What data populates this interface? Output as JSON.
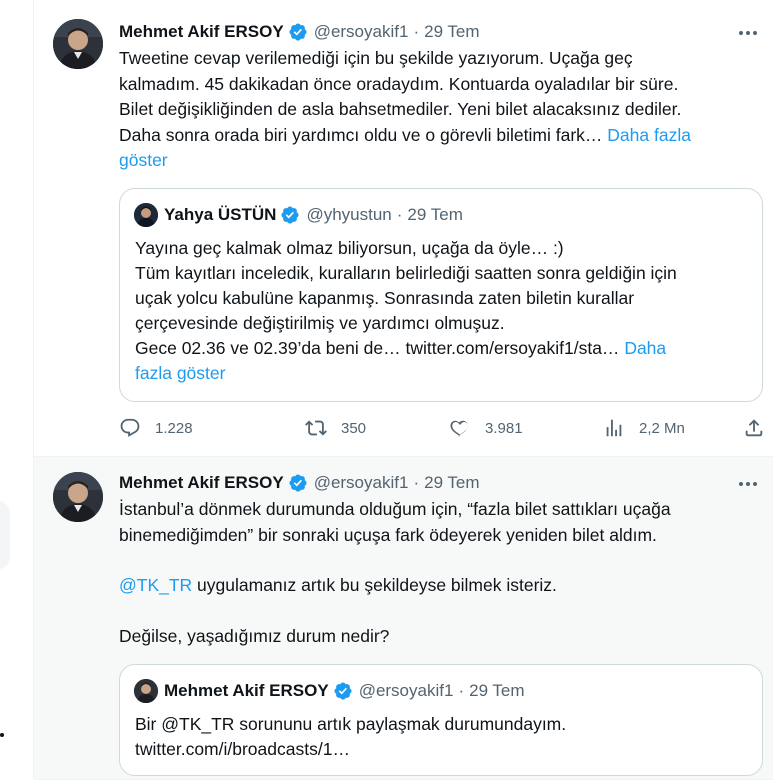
{
  "tweets": [
    {
      "author": {
        "name": "Mehmet Akif ERSOY",
        "handle": "@ersoyakif1",
        "separator": "·",
        "date": "29 Tem"
      },
      "text_lines": [
        "Tweetine cevap verilemediği için bu şekilde yazıyorum. Uçağa geç",
        "kalmadım. 45 dakikadan önce oradaydım. Kontuarda oyaladılar bir süre.",
        "Bilet değişikliğinden de asla bahsetmediler. Yeni bilet alacaksınız dediler.",
        "Daha sonra orada biri yardımcı oldu ve o görevli biletimi fark…"
      ],
      "show_more_1": "Daha fazla",
      "show_more_2": "göster",
      "quote": {
        "author": {
          "name": "Yahya ÜSTÜN",
          "handle": "@yhyustun",
          "separator": "·",
          "date": "29 Tem"
        },
        "lines": [
          "Yayına geç kalmak olmaz biliyorsun, uçağa da öyle… :)",
          "Tüm kayıtları inceledik, kuralların belirlediği saatten sonra geldiğin için",
          "uçak yolcu kabulüne kapanmış. Sonrasında zaten biletin kurallar",
          "çerçevesinde değiştirilmiş ve yardımcı olmuşuz.",
          "Gece 02.36 ve 02.39’da beni de… twitter.com/ersoyakif1/sta…"
        ],
        "show_more_1": "Daha",
        "show_more_2": "fazla göster"
      },
      "actions": {
        "replies": "1.228",
        "retweets": "350",
        "likes": "3.981",
        "views": "2,2 Mn"
      }
    },
    {
      "author": {
        "name": "Mehmet Akif ERSOY",
        "handle": "@ersoyakif1",
        "separator": "·",
        "date": "29 Tem"
      },
      "line1": "İstanbul’a dönmek durumunda olduğum için, “fazla bilet sattıkları uçağa",
      "line2": "binemediğimden” bir sonraki uçuşa fark ödeyerek yeniden bilet aldım.",
      "mention": "@TK_TR",
      "mention_rest": " uygulamanız artık bu şekildeyse bilmek isteriz.",
      "line4": "Değilse, yaşadığımız durum nedir?",
      "quote": {
        "author": {
          "name": "Mehmet Akif ERSOY",
          "handle": "@ersoyakif1",
          "separator": "·",
          "date": "29 Tem"
        },
        "lines": [
          "Bir @TK_TR sorununu artık paylaşmak durumundayım.",
          "twitter.com/i/broadcasts/1…"
        ]
      }
    }
  ],
  "colors": {
    "accent": "#1d9bf0",
    "text": "#0f1419",
    "muted": "#536471",
    "border": "#cfd9de"
  },
  "icons": [
    "verified-badge-icon",
    "more-icon",
    "reply-icon",
    "retweet-icon",
    "like-icon",
    "views-icon",
    "share-icon"
  ]
}
